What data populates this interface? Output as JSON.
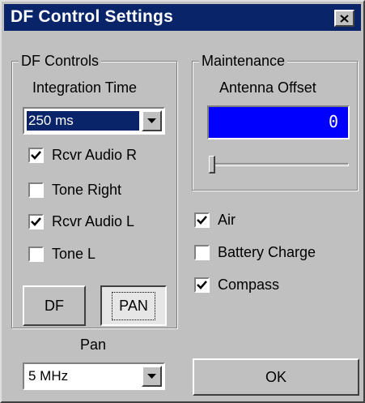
{
  "window": {
    "title": "DF Control Settings",
    "close_icon": "close-icon"
  },
  "df_controls": {
    "group_label": "DF Controls",
    "integration_label": "Integration Time",
    "integration_value": "250 ms",
    "checkboxes": [
      {
        "label": "Rcvr Audio R",
        "checked": true
      },
      {
        "label": "Tone Right",
        "checked": false
      },
      {
        "label": "Rcvr Audio L",
        "checked": true
      },
      {
        "label": "Tone L",
        "checked": false
      }
    ],
    "df_button": "DF",
    "pan_button": "PAN",
    "pan_label": "Pan",
    "pan_value": "5 MHz"
  },
  "maintenance": {
    "group_label": "Maintenance",
    "offset_label": "Antenna Offset",
    "offset_value": "0",
    "slider_level": 0
  },
  "options": [
    {
      "label": "Air",
      "checked": true
    },
    {
      "label": "Battery Charge",
      "checked": false
    },
    {
      "label": "Compass",
      "checked": true
    }
  ],
  "ok_button": "OK",
  "colors": {
    "titlebar": "#0a246a",
    "offset_bg": "#0000ff",
    "face": "#c0c0c0"
  }
}
